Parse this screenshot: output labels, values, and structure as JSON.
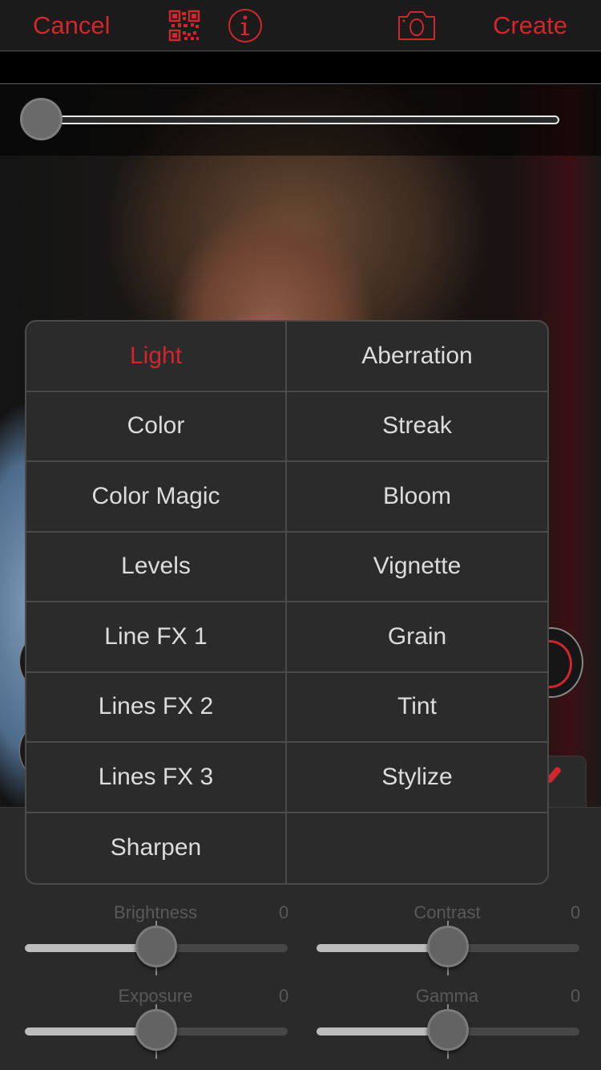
{
  "topbar": {
    "cancel_label": "Cancel",
    "create_label": "Create",
    "icons": [
      "qr-code-icon",
      "info-icon",
      "camera-icon"
    ],
    "accent_color": "#d1262b"
  },
  "top_slider": {
    "value_fraction": 0.0
  },
  "filter_menu": {
    "selected": "Light",
    "items": [
      {
        "label": "Light",
        "active": true
      },
      {
        "label": "Aberration",
        "active": false
      },
      {
        "label": "Color",
        "active": false
      },
      {
        "label": "Streak",
        "active": false
      },
      {
        "label": "Color Magic",
        "active": false
      },
      {
        "label": "Bloom",
        "active": false
      },
      {
        "label": "Levels",
        "active": false
      },
      {
        "label": "Vignette",
        "active": false
      },
      {
        "label": "Line FX 1",
        "active": false
      },
      {
        "label": "Grain",
        "active": false
      },
      {
        "label": "Lines FX 2",
        "active": false
      },
      {
        "label": "Tint",
        "active": false
      },
      {
        "label": "Lines FX 3",
        "active": false
      },
      {
        "label": "Stylize",
        "active": false
      },
      {
        "label": "Sharpen",
        "active": false
      },
      {
        "label": "",
        "active": false
      }
    ]
  },
  "adjustments": [
    {
      "label": "Brightness",
      "value": "0",
      "fraction": 0.5
    },
    {
      "label": "Contrast",
      "value": "0",
      "fraction": 0.5
    },
    {
      "label": "Exposure",
      "value": "0",
      "fraction": 0.5
    },
    {
      "label": "Gamma",
      "value": "0",
      "fraction": 0.5
    }
  ]
}
